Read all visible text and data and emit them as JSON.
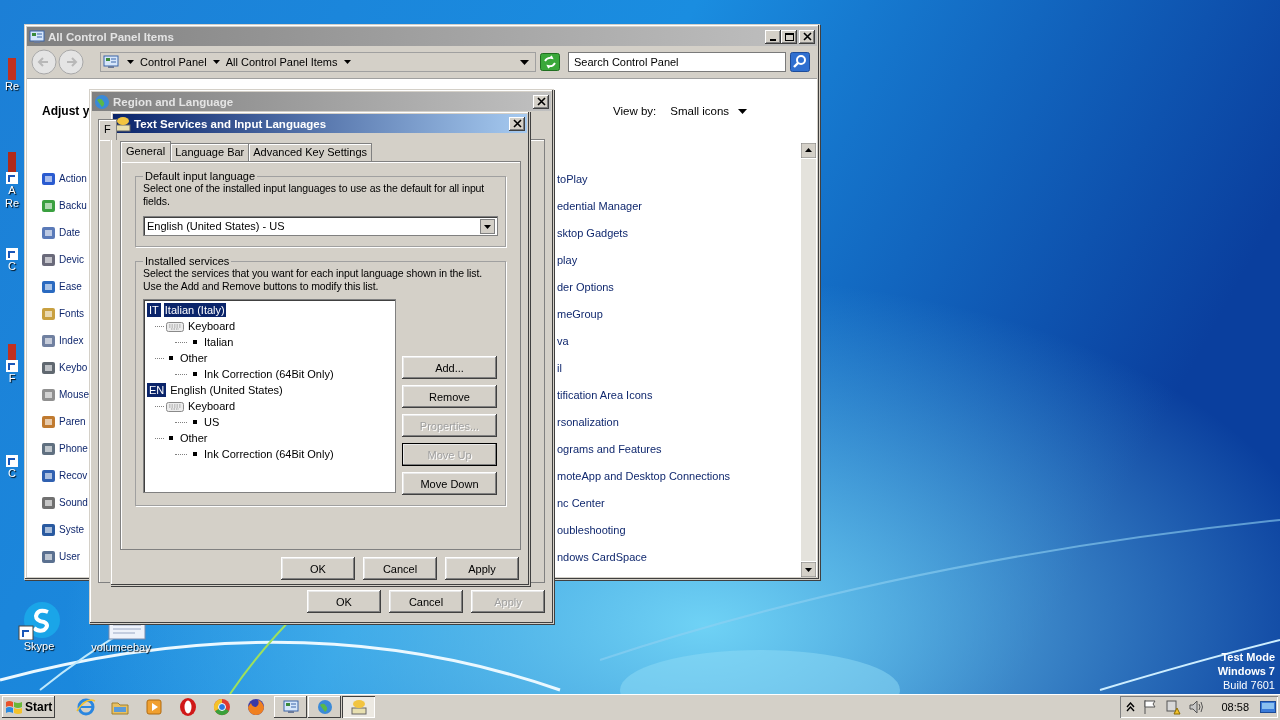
{
  "desktop": {
    "icons": [
      {
        "lines": [
          "Re"
        ]
      },
      {
        "lines": [
          "A",
          "Re"
        ]
      },
      {
        "lines": [
          "C"
        ]
      },
      {
        "lines": [
          "F"
        ]
      },
      {
        "lines": [
          "C"
        ]
      },
      {
        "lines": [
          "Skype"
        ]
      },
      {
        "lines": [
          "volumeebay"
        ]
      }
    ],
    "build_info": [
      "Test Mode",
      "Windows 7",
      "Build 7601"
    ]
  },
  "control_panel": {
    "title": "All Control Panel Items",
    "breadcrumb": [
      "Control Panel",
      "All Control Panel Items"
    ],
    "search": {
      "placeholder": "Search Control Panel"
    },
    "heading": "Adjust y",
    "view_by": {
      "label": "View by:",
      "value": "Small icons"
    },
    "items_left": [
      "Action",
      "Backu",
      "Date",
      "Devic",
      "Ease",
      "Fonts",
      "Index",
      "Keybo",
      "Mouse",
      "Paren",
      "Phone",
      "Recov",
      "Sound",
      "Syste",
      "User"
    ],
    "items_right": [
      "toPlay",
      "edential Manager",
      "sktop Gadgets",
      "play",
      "der Options",
      "meGroup",
      "va",
      "il",
      "tification Area Icons",
      "rsonalization",
      "ograms and Features",
      "moteApp and Desktop Connections",
      "nc Center",
      "oubleshooting",
      "ndows CardSpace"
    ]
  },
  "region_dialog": {
    "title": "Region and Language",
    "tabs": [
      {
        "label": "F",
        "selected": true
      }
    ],
    "buttons": [
      {
        "label": "OK",
        "disabled": false
      },
      {
        "label": "Cancel",
        "disabled": false
      },
      {
        "label": "Apply",
        "disabled": true
      }
    ]
  },
  "text_services_dialog": {
    "title": "Text Services and Input Languages",
    "tabs": [
      {
        "label": "General",
        "selected": true
      },
      {
        "label": "Language Bar",
        "selected": false
      },
      {
        "label": "Advanced Key Settings",
        "selected": false
      }
    ],
    "default_language": {
      "group": "Default input language",
      "description": "Select one of the installed input languages to use as the default for all input fields.",
      "value": "English (United States) - US"
    },
    "installed_services": {
      "group": "Installed services",
      "description": "Select the services that you want for each input language shown in the list. Use the Add and Remove buttons to modify this list.",
      "tree": [
        {
          "kind": "language",
          "badge": "IT",
          "label": "Italian (Italy)",
          "selected": true,
          "children": [
            {
              "kind": "keyboard",
              "label": "Keyboard",
              "selected": false,
              "children": [
                {
                  "kind": "bullet",
                  "label": "Italian",
                  "selected": false
                }
              ]
            },
            {
              "kind": "bullet",
              "label": "Other",
              "selected": false,
              "children": [
                {
                  "kind": "bullet",
                  "label": "Ink Correction (64Bit Only)",
                  "selected": false
                }
              ]
            }
          ]
        },
        {
          "kind": "language",
          "badge": "EN",
          "label": "English (United States)",
          "selected": false,
          "children": [
            {
              "kind": "keyboard",
              "label": "Keyboard",
              "selected": false,
              "children": [
                {
                  "kind": "bullet",
                  "label": "US",
                  "selected": false
                }
              ]
            },
            {
              "kind": "bullet",
              "label": "Other",
              "selected": false,
              "children": [
                {
                  "kind": "bullet",
                  "label": "Ink Correction (64Bit Only)",
                  "selected": false
                }
              ]
            }
          ]
        }
      ],
      "buttons": [
        {
          "label": "Add...",
          "disabled": false,
          "focused": false
        },
        {
          "label": "Remove",
          "disabled": false,
          "focused": false
        },
        {
          "label": "Properties...",
          "disabled": true,
          "focused": false
        },
        {
          "label": "Move Up",
          "disabled": true,
          "focused": true
        },
        {
          "label": "Move Down",
          "disabled": false,
          "focused": false
        }
      ]
    },
    "buttons": [
      {
        "label": "OK",
        "disabled": false
      },
      {
        "label": "Cancel",
        "disabled": false
      },
      {
        "label": "Apply",
        "disabled": false
      }
    ]
  },
  "taskbar": {
    "start": "Start",
    "tasks": [
      {
        "selected": false
      },
      {
        "selected": false
      },
      {
        "selected": true
      }
    ],
    "clock": "08:58"
  }
}
